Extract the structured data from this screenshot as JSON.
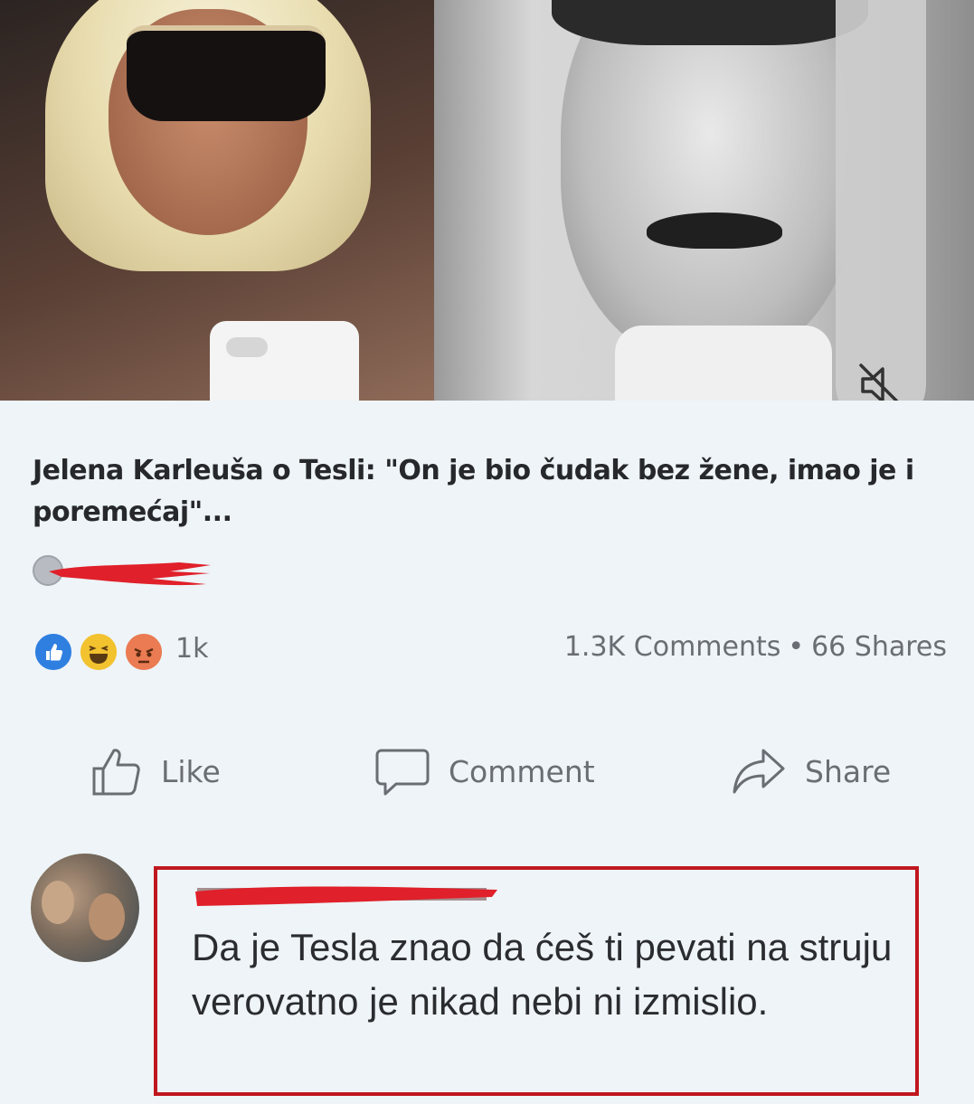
{
  "post": {
    "headline": "Jelena Karleuša o Tesli: \"On je bio čudak bez žene, imao je i poremećaj\"...",
    "media": {
      "mute_icon": "speaker-muted-icon"
    },
    "source": {
      "avatar_icon": "source-avatar-icon"
    }
  },
  "reactions": {
    "icons": [
      "like-reaction-icon",
      "haha-reaction-icon",
      "angry-reaction-icon"
    ],
    "count": "1k"
  },
  "stats": {
    "comments": "1.3K Comments",
    "separator": "•",
    "shares": "66 Shares"
  },
  "actions": {
    "like": "Like",
    "comment": "Comment",
    "share": "Share"
  },
  "comment": {
    "text": "Da je Tesla znao da ćeš ti pevati na struju verovatno je nikad nebi ni izmislio."
  },
  "colors": {
    "background": "#eef4f7",
    "text": "#26282c",
    "muted": "#6a6e74",
    "like_blue": "#2f7fe0",
    "haha_yellow": "#f2c22f",
    "angry_orange": "#ea7b52",
    "highlight_red": "#c0171f",
    "redaction_red": "#e0202a"
  }
}
